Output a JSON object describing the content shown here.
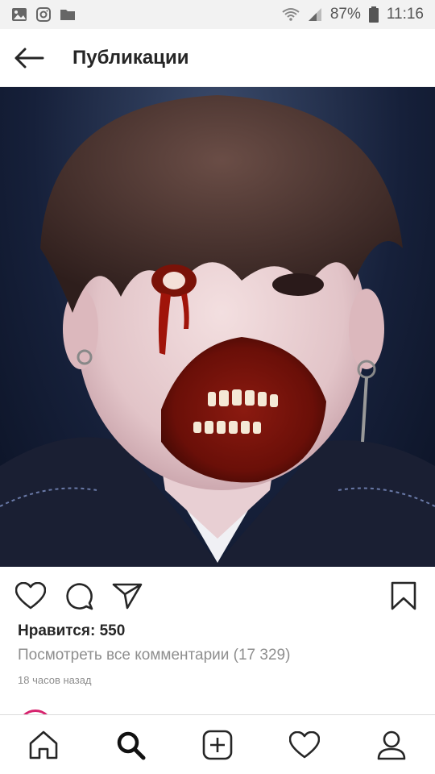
{
  "status_bar": {
    "battery": "87%",
    "time": "11:16",
    "icons": [
      "image-icon",
      "instagram-icon",
      "folder-icon",
      "wifi-icon",
      "signal-icon",
      "battery-icon"
    ]
  },
  "header": {
    "title": "Публикации",
    "back_icon": "arrow-left-icon"
  },
  "post": {
    "likes": "Нравится: 550",
    "view_comments": "Посмотреть все комментарии (17 329)",
    "time_ago": "18 часов назад",
    "actions": [
      "heart-icon",
      "comment-icon",
      "share-icon",
      "bookmark-icon"
    ]
  },
  "bottom_nav": {
    "items": [
      "home-icon",
      "search-icon",
      "add-icon",
      "activity-heart-icon",
      "profile-icon"
    ]
  },
  "colors": {
    "status_bar_bg": "#f2f2f2",
    "text_primary": "#262626",
    "text_secondary": "#8e8e8e",
    "story_ring": "#d6246e"
  }
}
